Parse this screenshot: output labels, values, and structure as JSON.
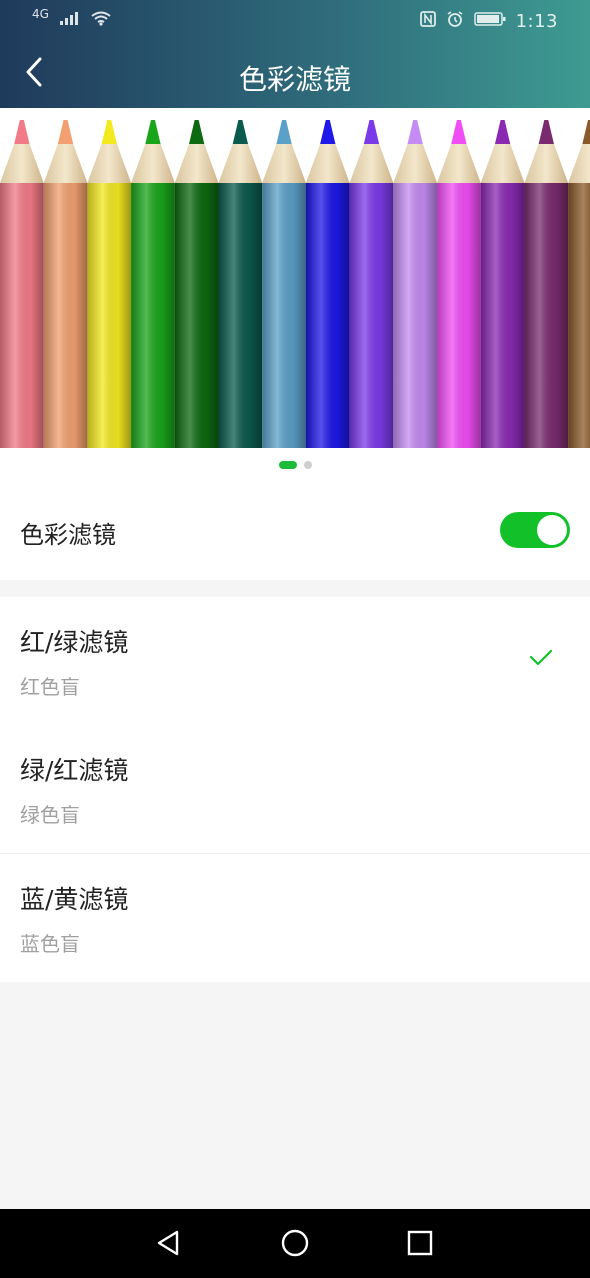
{
  "status_bar": {
    "network": "4G",
    "time": "1:13"
  },
  "header": {
    "title": "色彩滤镜"
  },
  "banner": {
    "pencil_colors": [
      "#f27a87",
      "#f2a070",
      "#f2e920",
      "#19a51a",
      "#0d6a10",
      "#0b5a4e",
      "#5aa0c8",
      "#1e18e8",
      "#7b3ae8",
      "#c48cf2",
      "#f04df5",
      "#8a2ab3",
      "#7a2b6f",
      "#8a5a2a"
    ],
    "pages": 2,
    "current_page": 1
  },
  "toggle": {
    "label": "色彩滤镜",
    "enabled": true
  },
  "options": [
    {
      "title": "红/绿滤镜",
      "subtitle": "红色盲",
      "selected": true
    },
    {
      "title": "绿/红滤镜",
      "subtitle": "绿色盲",
      "selected": false
    },
    {
      "title": "蓝/黄滤镜",
      "subtitle": "蓝色盲",
      "selected": false
    }
  ],
  "colors": {
    "accent": "#12c12a",
    "header_gradient_left": "#1f3a5b",
    "header_gradient_right": "#3e9b92"
  }
}
